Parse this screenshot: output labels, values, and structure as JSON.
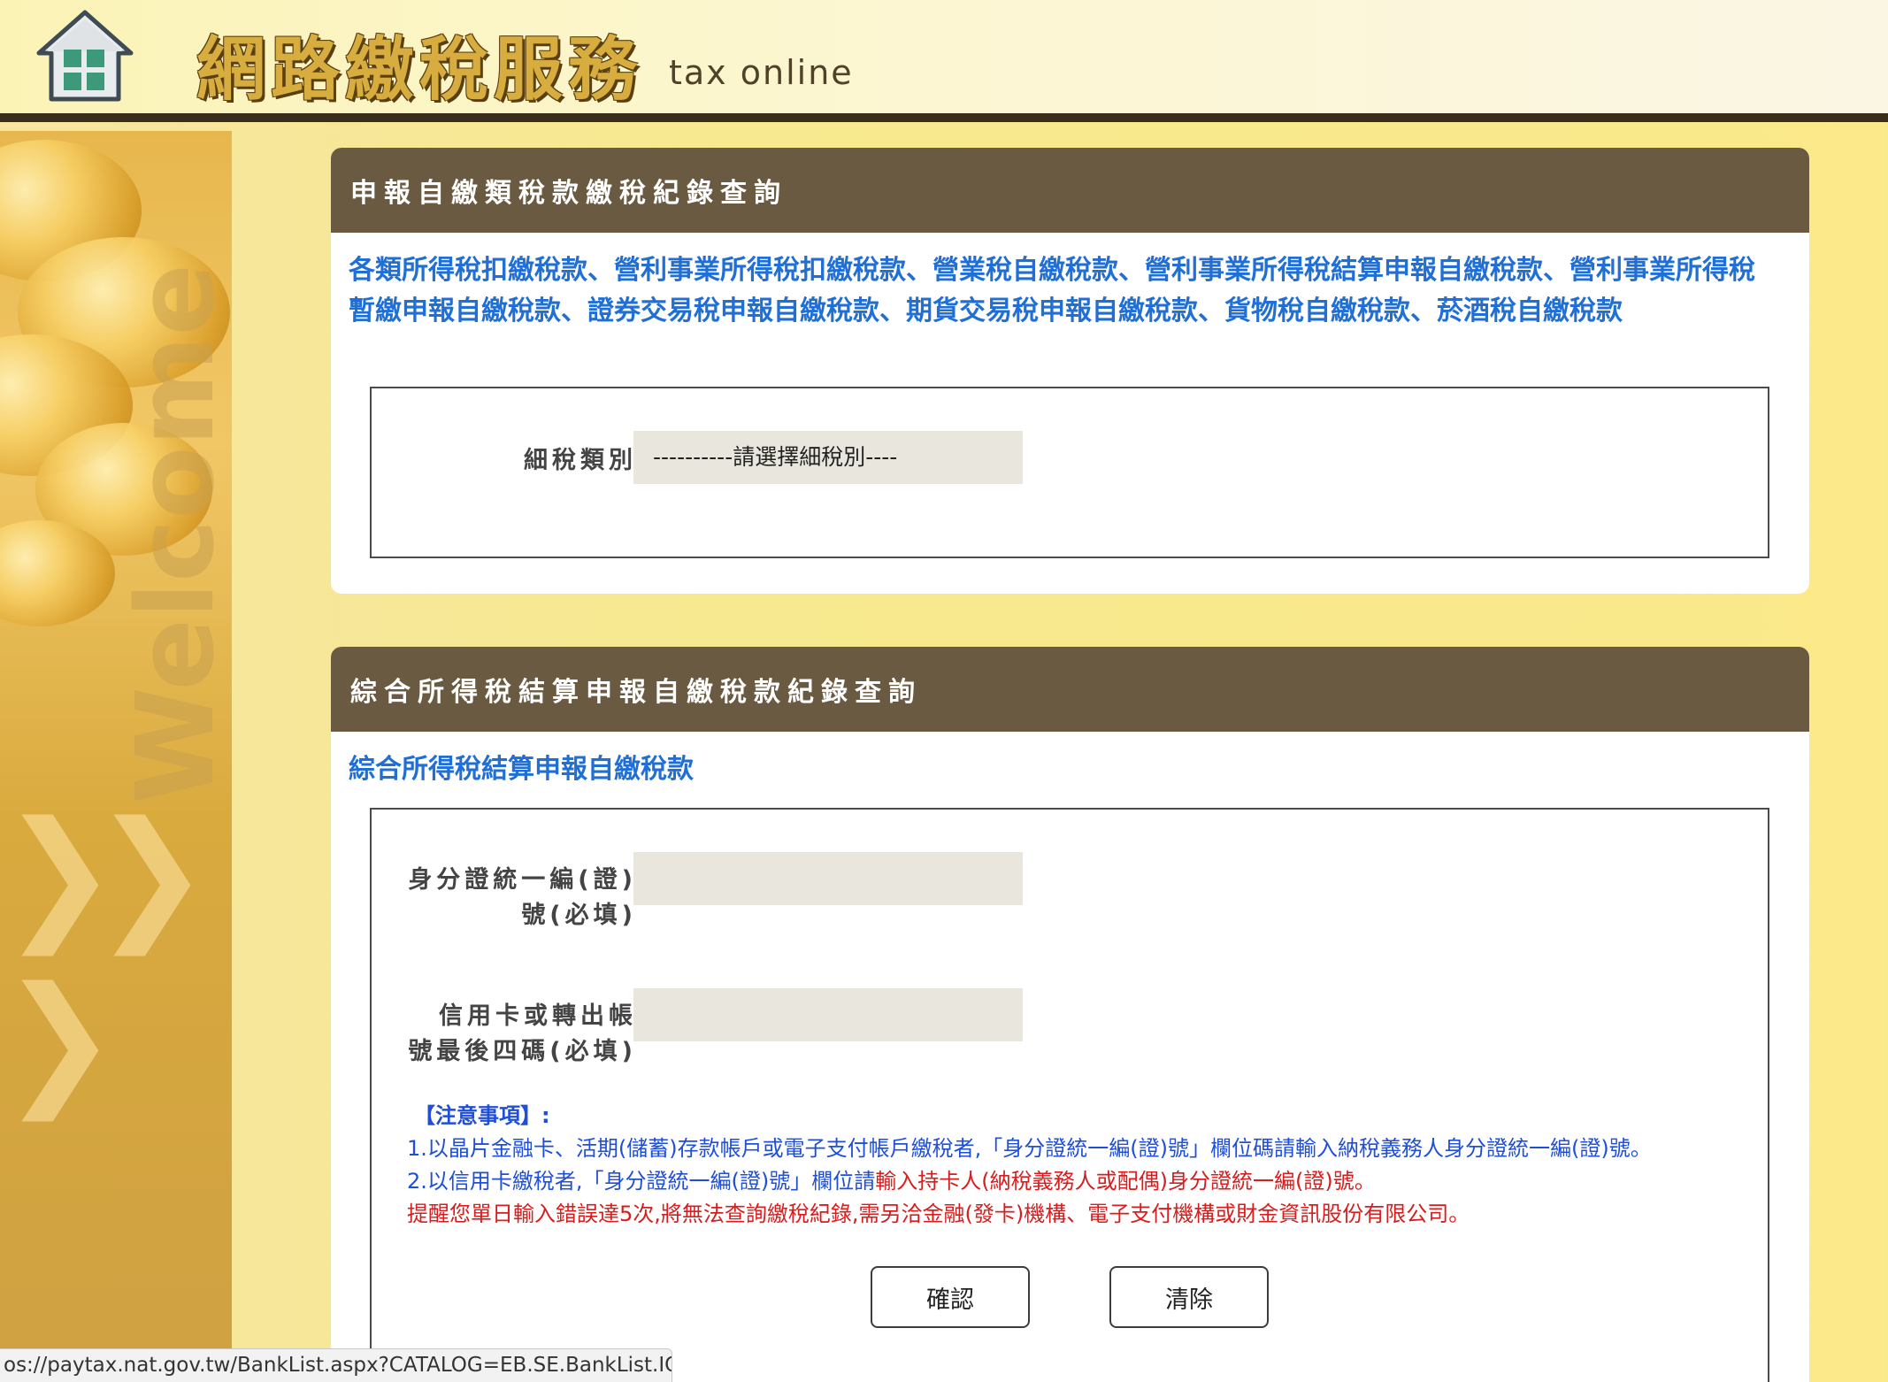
{
  "header": {
    "title": "網路繳稅服務",
    "subtitle": "tax online"
  },
  "decor": {
    "welcome": "Welcome"
  },
  "panel1": {
    "heading": "申報自繳類稅款繳稅紀錄查詢",
    "description": "各類所得稅扣繳稅款、營利事業所得稅扣繳稅款、營業稅自繳稅款、營利事業所得稅結算申報自繳稅款、營利事業所得稅暫繳申報自繳稅款、證券交易稅申報自繳稅款、期貨交易稅申報自繳稅款、貨物稅自繳稅款、菸酒稅自繳稅款",
    "tax_type_label": "細稅類別",
    "tax_type_selected": "----------請選擇細稅別----"
  },
  "panel2": {
    "heading": "綜合所得稅結算申報自繳稅款紀錄查詢",
    "description": "綜合所得稅結算申報自繳稅款",
    "id_label_line1": "身分證統一編(證)",
    "id_label_line2": "號(必填)",
    "id_value": "",
    "card_label_line1": "信用卡或轉出帳",
    "card_label_line2": "號最後四碼(必填)",
    "card_value": "",
    "notes_heading": "【注意事項】:",
    "note1": "1.以晶片金融卡、活期(儲蓄)存款帳戶或電子支付帳戶繳稅者,「身分證統一編(證)號」欄位碼請輸入納稅義務人身分證統一編(證)號。",
    "note2_blue": "2.以信用卡繳稅者,「身分證統一編(證)號」欄位請",
    "note2_red": "輸入持卡人(納稅義務人或配偶)身分證統一編(證)號。",
    "note3": "提醒您單日輸入錯誤達5次,將無法查詢繳稅紀錄,需另洽金融(發卡)機構、電子支付機構或財金資訊股份有限公司。",
    "confirm_label": "確認",
    "clear_label": "清除"
  },
  "statusbar": {
    "url": "os://paytax.nat.gov.tw/BankList.aspx?CATALOG=EB.SE.BankList.IC"
  },
  "colors": {
    "header_bar": "#6a5a42",
    "link_blue": "#1f6fd6",
    "warning_red": "#d71d1d"
  }
}
